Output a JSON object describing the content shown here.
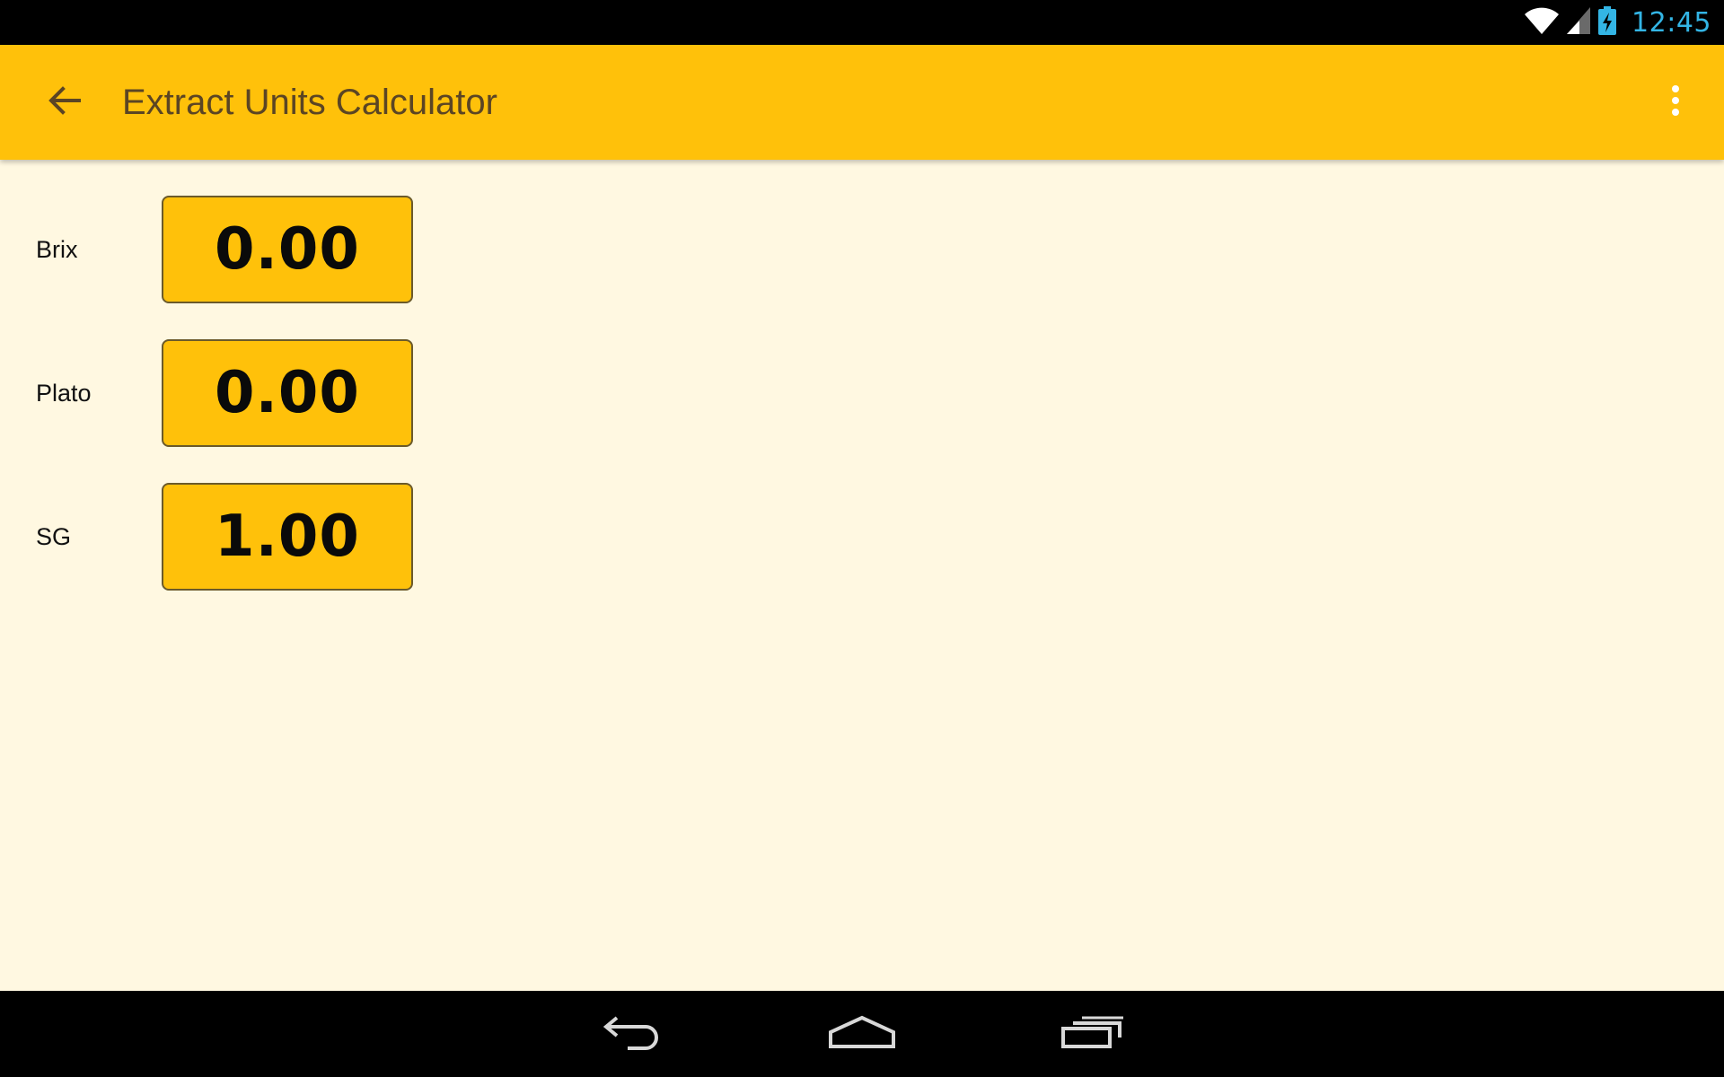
{
  "status_bar": {
    "time": "12:45",
    "icons": [
      "wifi-icon",
      "cell-signal-icon",
      "battery-charging-icon"
    ],
    "time_color": "#33b5e5"
  },
  "app_bar": {
    "title": "Extract Units Calculator",
    "back_icon": "arrow-back-icon",
    "overflow_icon": "more-vert-icon",
    "color": "#ffc10a"
  },
  "fields": [
    {
      "label": "Brix",
      "value": "0.00"
    },
    {
      "label": "Plato",
      "value": "0.00"
    },
    {
      "label": "SG",
      "value": "1.00"
    }
  ],
  "nav_bar": {
    "buttons": [
      "back-nav-icon",
      "home-nav-icon",
      "recent-apps-icon"
    ]
  },
  "colors": {
    "accent": "#ffc10a",
    "background": "#fff8e1",
    "title_text": "#5b4524"
  }
}
